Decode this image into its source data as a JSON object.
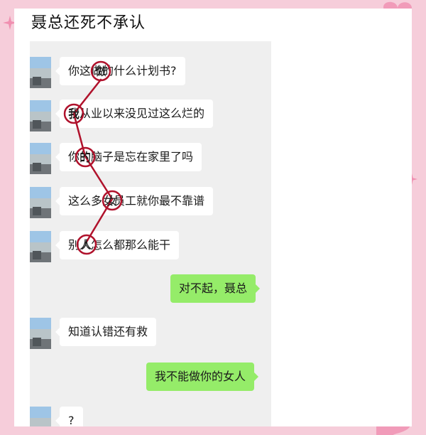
{
  "title": "聂总还死不承认",
  "colors": {
    "background_pink": "#f6cdda",
    "chat_background": "#efefef",
    "incoming_bubble": "#ffffff",
    "outgoing_bubble": "#95ec69",
    "annotation_red": "#b0122c"
  },
  "messages": [
    {
      "side": "left",
      "text": "你这做的什么计划书?"
    },
    {
      "side": "left",
      "text": "我从业以来没见过这么烂的"
    },
    {
      "side": "left",
      "text": "你的脑子是忘在家里了吗"
    },
    {
      "side": "left",
      "text": "这么多女员工就你最不靠谱"
    },
    {
      "side": "left",
      "text": "别人怎么都那么能干"
    },
    {
      "side": "right",
      "text": "对不起，聂总"
    },
    {
      "side": "left",
      "text": "知道认错还有救"
    },
    {
      "side": "right",
      "text": "我不能做你的女人"
    },
    {
      "side": "left",
      "text": "?"
    }
  ],
  "hidden_message_chars": [
    "做",
    "我",
    "的",
    "女",
    "人"
  ]
}
